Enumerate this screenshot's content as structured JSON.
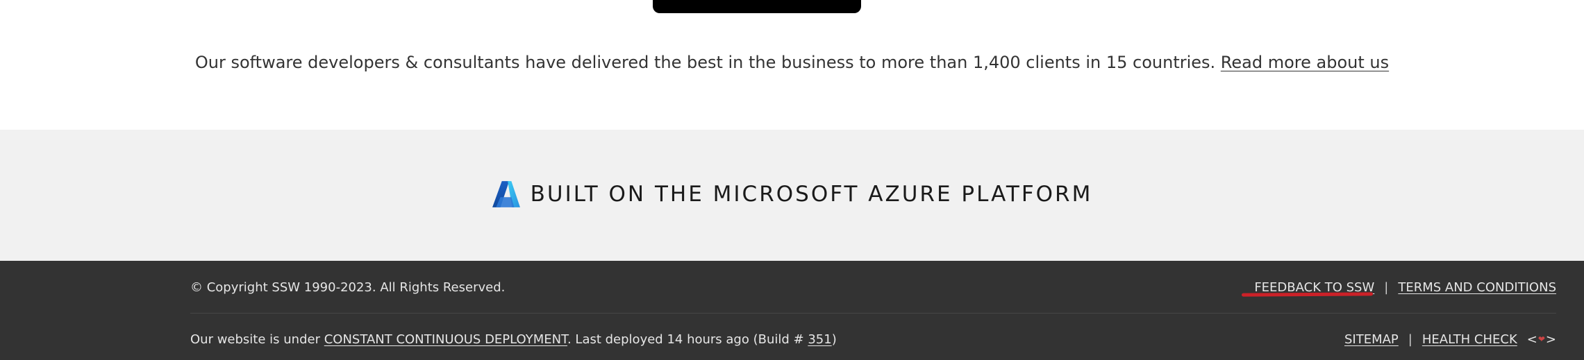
{
  "about": {
    "text": "Our software developers & consultants have delivered the best in the business to more than 1,400 clients in 15 countries.",
    "link": "Read more about us"
  },
  "azure": {
    "title": "BUILT ON THE MICROSOFT AZURE PLATFORM",
    "icon": "azure-logo-icon"
  },
  "footer": {
    "copyright": "© Copyright SSW 1990-2023. All Rights Reserved.",
    "feedback": "FEEDBACK TO SSW",
    "terms": "TERMS AND CONDITIONS",
    "separator": "|",
    "deploy_prefix": "Our website is under",
    "deploy_link": "CONSTANT CONTINUOUS DEPLOYMENT",
    "deploy_suffix": ". Last deployed 14 hours ago (Build #",
    "build_number": "351",
    "deploy_end": ")",
    "sitemap": "SITEMAP",
    "health": "HEALTH CHECK",
    "code_lt": "<",
    "code_gt": ">",
    "heart": "❤"
  },
  "colors": {
    "footer_bg": "#333333",
    "band_bg": "#f1f1f1",
    "accent_red": "#cc2128"
  }
}
